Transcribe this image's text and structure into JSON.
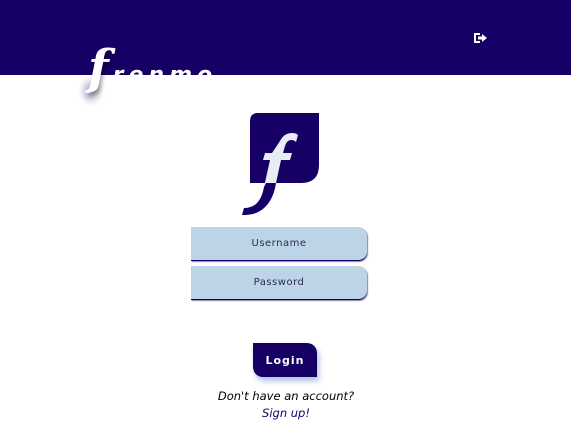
{
  "header": {
    "brand_initial": "f",
    "brand_rest": "renmo",
    "logout_icon": "sign-out-icon"
  },
  "logo": {
    "icon": "frenmo-f-logo-icon"
  },
  "form": {
    "username_placeholder": "Username",
    "password_placeholder": "Password",
    "login_label": "Login"
  },
  "footer": {
    "prompt": "Don't have an account?",
    "signup_label": "Sign up!"
  },
  "colors": {
    "primary": "#170065",
    "field_bg": "#bdd4e6",
    "background": "#ffffff"
  }
}
